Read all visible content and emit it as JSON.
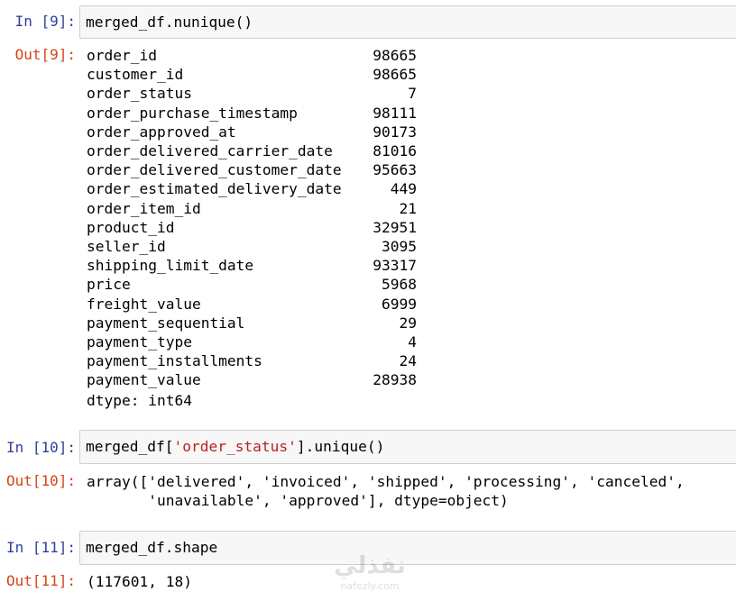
{
  "cells": {
    "c9": {
      "in_prompt": "In [9]:",
      "code": "merged_df.nunique()",
      "out_prompt": "Out[9]:",
      "rows": [
        {
          "key": "order_id",
          "value": "98665"
        },
        {
          "key": "customer_id",
          "value": "98665"
        },
        {
          "key": "order_status",
          "value": "7"
        },
        {
          "key": "order_purchase_timestamp",
          "value": "98111"
        },
        {
          "key": "order_approved_at",
          "value": "90173"
        },
        {
          "key": "order_delivered_carrier_date",
          "value": "81016"
        },
        {
          "key": "order_delivered_customer_date",
          "value": "95663"
        },
        {
          "key": "order_estimated_delivery_date",
          "value": "449"
        },
        {
          "key": "order_item_id",
          "value": "21"
        },
        {
          "key": "product_id",
          "value": "32951"
        },
        {
          "key": "seller_id",
          "value": "3095"
        },
        {
          "key": "shipping_limit_date",
          "value": "93317"
        },
        {
          "key": "price",
          "value": "5968"
        },
        {
          "key": "freight_value",
          "value": "6999"
        },
        {
          "key": "payment_sequential",
          "value": "29"
        },
        {
          "key": "payment_type",
          "value": "4"
        },
        {
          "key": "payment_installments",
          "value": "24"
        },
        {
          "key": "payment_value",
          "value": "28938"
        }
      ],
      "dtype": "dtype: int64"
    },
    "c10": {
      "in_prompt": "In [10]:",
      "code_prefix": "merged_df[",
      "code_string": "'order_status'",
      "code_suffix": "].unique()",
      "out_prompt": "Out[10]:",
      "out_line1": "array(['delivered', 'invoiced', 'shipped', 'processing', 'canceled',",
      "out_line2": "       'unavailable', 'approved'], dtype=object)"
    },
    "c11": {
      "in_prompt": "In [11]:",
      "code": "merged_df.shape",
      "out_prompt": "Out[11]:",
      "output": "(117601, 18)"
    }
  },
  "watermark": {
    "logo": "نفذلي",
    "text": "nafezly.com"
  },
  "colors": {
    "in_prompt": "#303f9f",
    "out_prompt": "#d84315",
    "string": "#ba2121",
    "input_bg": "#f7f7f7"
  }
}
